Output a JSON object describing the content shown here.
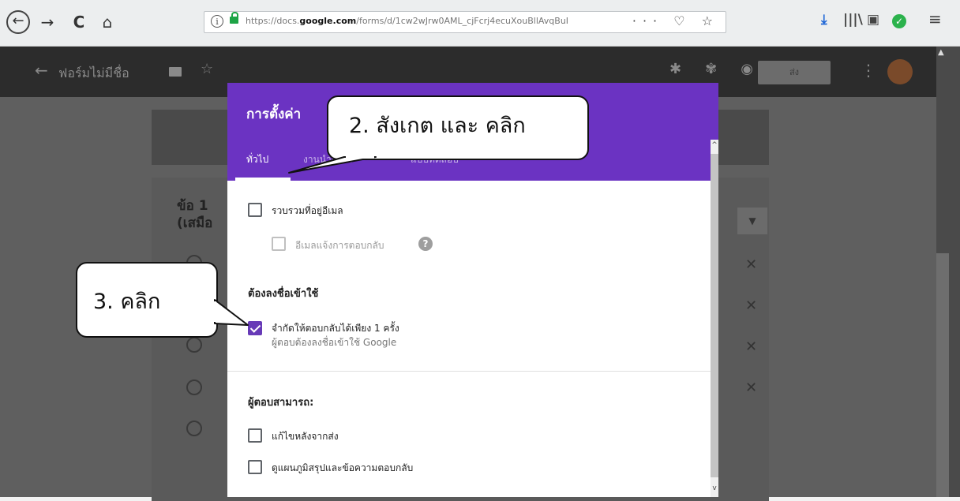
{
  "browser": {
    "nav": {
      "back": "←",
      "forward": "→",
      "reload": "C",
      "home": "⌂"
    },
    "url": {
      "prefix": "https://docs.",
      "domain": "google.com",
      "path": "/forms/d/1cw2wJrw0AML_cjFcrj4ecuXouBllAvqBuI",
      "actions": "··· ♡ ☆"
    },
    "toolbar_icons": [
      "download-icon",
      "library-icon",
      "sidebar-icon",
      "check-icon",
      "menu-icon"
    ]
  },
  "forms_app": {
    "title": "ฟอร์มไม่มีชื่อ",
    "send_label": "ส่ง",
    "question_title_line1": "ข้อ 1",
    "question_title_line2": "(เสมือ"
  },
  "dialog": {
    "title": "การตั้งค่า",
    "tabs": [
      "ทั่วไป",
      "งานนำเสนอ",
      "แบบทดสอบ"
    ],
    "active_tab": 0,
    "collect_email": {
      "label": "รวบรวมที่อยู่อีเมล",
      "checked": false
    },
    "email_receipts": {
      "label": "อีเมลแจ้งการตอบกลับ",
      "checked": false,
      "disabled": true
    },
    "requires_signin": {
      "heading": "ต้องลงชื่อเข้าใช้",
      "limit_label": "จำกัดให้ตอบกลับได้เพียง 1 ครั้ง",
      "limit_sub": "ผู้ตอบต้องลงชื่อเข้าใช้ Google",
      "checked": true
    },
    "respondents_can": {
      "heading": "ผู้ตอบสามารถ:",
      "edit_label": "แก้ไขหลังจากส่ง",
      "summary_label": "ดูแผนภูมิสรุปและข้อความตอบกลับ"
    }
  },
  "annotations": {
    "step2": "2. สังเกต และ คลิก",
    "step3": "3. คลิก"
  },
  "colors": {
    "accent": "#6b33c2",
    "checkbox": "#673ab7",
    "overlay": "#5f5f5f"
  }
}
